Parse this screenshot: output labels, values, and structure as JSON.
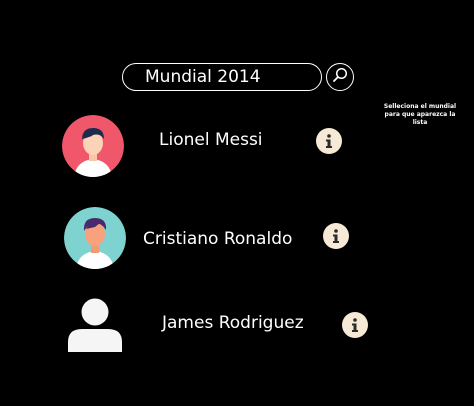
{
  "search": {
    "value": "Mundial 2014",
    "icon": "search-icon"
  },
  "hint_text": "Selleciona el mundial para que aparezca la lista",
  "players": [
    {
      "name": "Lionel Messi",
      "avatar_bg": "#f0576a",
      "icon": "info-icon"
    },
    {
      "name": "Cristiano Ronaldo",
      "avatar_bg": "#7ed2cf",
      "icon": "info-icon"
    },
    {
      "name": "James Rodriguez",
      "avatar_bg": "#000000",
      "icon": "info-icon"
    }
  ],
  "colors": {
    "background": "#000000",
    "text": "#ffffff",
    "info_button": "#f6ead6",
    "info_glyph": "#2b2b2b"
  }
}
